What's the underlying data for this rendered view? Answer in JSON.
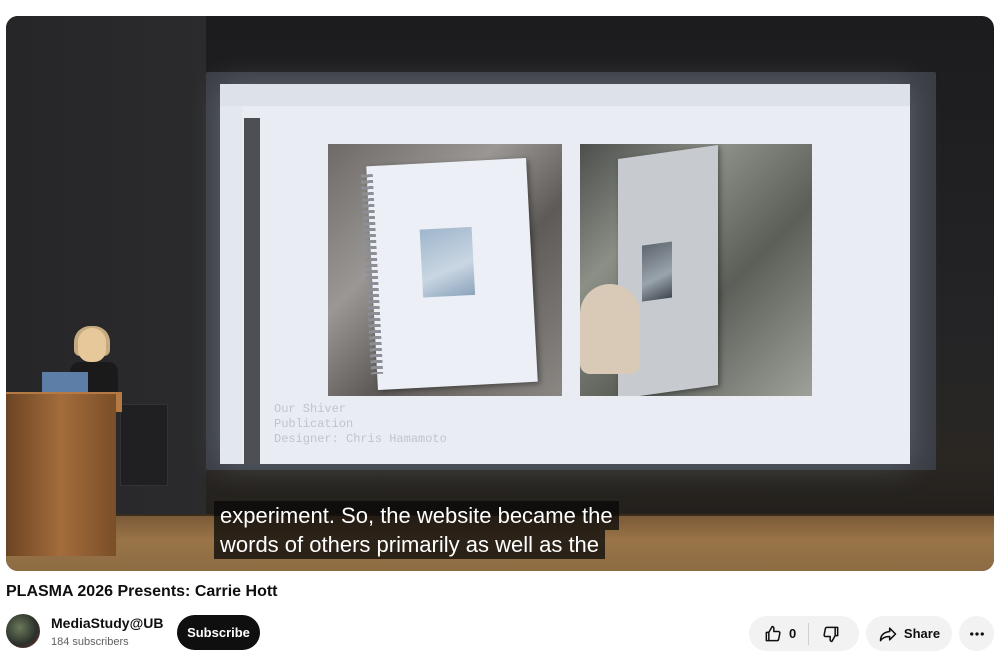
{
  "video": {
    "subtitle_lines": [
      "experiment. So, the website became the",
      "words of others primarily as well as the"
    ],
    "slide_caption": [
      "Our Shiver",
      "Publication",
      "Designer: Chris Hamamoto"
    ]
  },
  "title": "PLASMA 2026 Presents: Carrie Hott",
  "channel": {
    "name": "MediaStudy@UB",
    "subscribers": "184 subscribers"
  },
  "actions": {
    "subscribe_label": "Subscribe",
    "like_count": "0",
    "share_label": "Share"
  },
  "icons": {
    "like": "thumb-up-icon",
    "dislike": "thumb-down-icon",
    "share": "share-arrow-icon",
    "more": "more-horizontal-icon"
  },
  "colors": {
    "subscribe_bg": "#0f0f0f",
    "pill_bg": "#f2f2f2",
    "subtitle_bg": "rgba(8,8,8,0.75)"
  }
}
